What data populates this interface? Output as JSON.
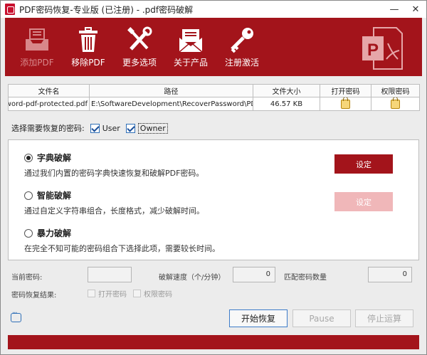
{
  "window": {
    "title": "PDF密码恢复-专业版 (已注册) - .pdf密码破解",
    "minimize": "—",
    "close": "✕"
  },
  "toolbar": {
    "add_pdf": "添加PDF",
    "remove_pdf": "移除PDF",
    "more_options": "更多选项",
    "about": "关于产品",
    "register": "注册激活"
  },
  "file_table": {
    "headers": [
      "文件名",
      "路径",
      "文件大小",
      "打开密码",
      "权限密码"
    ],
    "rows": [
      {
        "filename": "password-pdf-protected.pdf",
        "path": "E:\\SoftwareDevelopment\\RecoverPassword\\PDF Password",
        "size": "46.57 KB"
      }
    ]
  },
  "password_select": {
    "label": "选择需要恢复的密码:",
    "user": "User",
    "owner": "Owner",
    "user_checked": true,
    "owner_checked": true
  },
  "options": [
    {
      "title": "字典破解",
      "desc": "通过我们内置的密码字典快速恢复和破解PDF密码。",
      "selected": true,
      "button": "设定",
      "button_enabled": true
    },
    {
      "title": "智能破解",
      "desc": "通过自定义字符串组合，长度格式，减少破解时间。",
      "selected": false,
      "button": "设定",
      "button_enabled": false
    },
    {
      "title": "暴力破解",
      "desc": "在完全不知可能的密码组合下选择此项，需要较长时间。",
      "selected": false
    }
  ],
  "status": {
    "current_pwd_label": "当前密码:",
    "current_pwd_value": "",
    "speed_label": "破解速度（个/分钟）",
    "speed_value": "0",
    "match_label": "匹配密码数量",
    "match_value": "0",
    "result_label": "密码恢复结果:",
    "open_pwd": "打开密码",
    "perm_pwd": "权限密码"
  },
  "buttons": {
    "start": "开始恢复",
    "pause": "Pause",
    "stop": "停止运算"
  },
  "colors": {
    "brand_red": "#a3141b",
    "disabled_red": "#f0b7b9"
  }
}
